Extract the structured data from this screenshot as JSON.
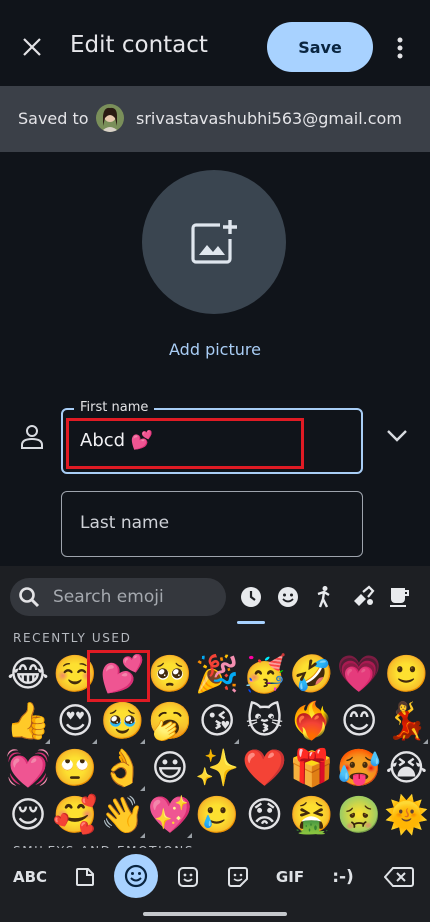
{
  "header": {
    "title": "Edit contact",
    "save_label": "Save",
    "icons": [
      "close-icon",
      "more-vert-icon"
    ]
  },
  "account": {
    "saved_to_label": "Saved to",
    "email": "srivastavashubhi563@gmail.com"
  },
  "photo": {
    "add_label": "Add picture",
    "icon": "add-photo-icon"
  },
  "form": {
    "first_name_label": "First name",
    "first_name_value": "Abcd 💕",
    "last_name_placeholder": "Last name",
    "icons": [
      "person-icon",
      "chevron-down-icon"
    ]
  },
  "emoji_keyboard": {
    "search_placeholder": "Search emoji",
    "categories": [
      "recent-icon",
      "smileys-icon",
      "activity-icon",
      "objects-icon",
      "food-icon"
    ],
    "recently_used_label": "RECENTLY USED",
    "next_section_label": "SMILEYS AND EMOTIONS",
    "rows": [
      [
        "😂",
        "☺️",
        "💕",
        "🥺",
        "🎉",
        "🥳",
        "🤣",
        "💗",
        "🙂"
      ],
      [
        "👍",
        "😍",
        "🥹",
        "🥱",
        "😘",
        "😽",
        "❤️‍🔥",
        "😊",
        "💃"
      ],
      [
        "💓",
        "🙄",
        "👌",
        "😃",
        "✨",
        "❤️",
        "🎁",
        "🥵",
        "😭"
      ],
      [
        "😌",
        "🥰",
        "👋",
        "💖",
        "🥲",
        "😟",
        "🤮",
        "🤢",
        "🌞"
      ]
    ]
  },
  "keyboard_toolbar": {
    "abc_label": "ABC",
    "gif_label": "GIF",
    "emoticon_label": ":-)"
  },
  "colors": {
    "accent": "#a8d2ff",
    "highlight": "#e01b24",
    "background": "#10141a"
  }
}
